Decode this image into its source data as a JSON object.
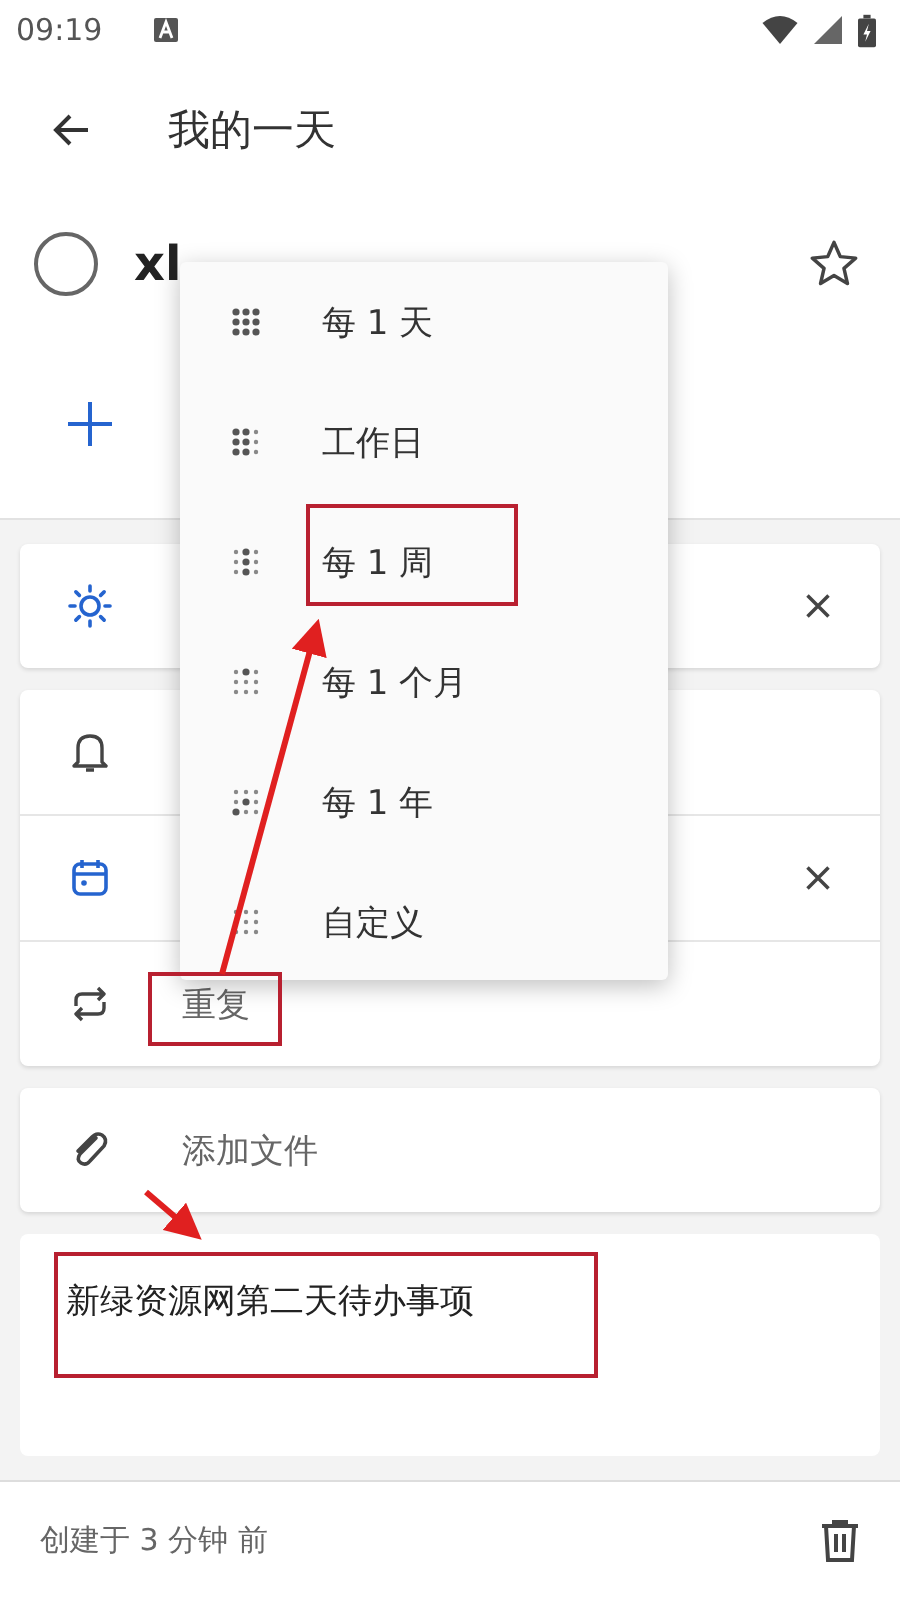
{
  "status_bar": {
    "time": "09:19"
  },
  "header": {
    "title": "我的一天"
  },
  "task": {
    "title": "xl",
    "completed": false,
    "starred": false
  },
  "cards": [
    {
      "rows": [
        {
          "kind": "sun",
          "removable": true
        }
      ]
    },
    {
      "rows": [
        {
          "kind": "bell",
          "removable": false
        },
        {
          "kind": "calendar",
          "removable": true
        },
        {
          "kind": "repeat",
          "text": "重复",
          "removable": false
        }
      ]
    },
    {
      "rows": [
        {
          "kind": "attach",
          "text": "添加文件",
          "removable": false
        }
      ]
    }
  ],
  "note": {
    "text": "新绿资源网第二天待办事项"
  },
  "repeat_menu": {
    "items": [
      {
        "label": "每 1 天"
      },
      {
        "label": "工作日"
      },
      {
        "label": "每 1 周"
      },
      {
        "label": "每 1 个月"
      },
      {
        "label": "每 1 年"
      },
      {
        "label": "自定义"
      }
    ]
  },
  "footer": {
    "created": "创建于 3 分钟 前"
  }
}
